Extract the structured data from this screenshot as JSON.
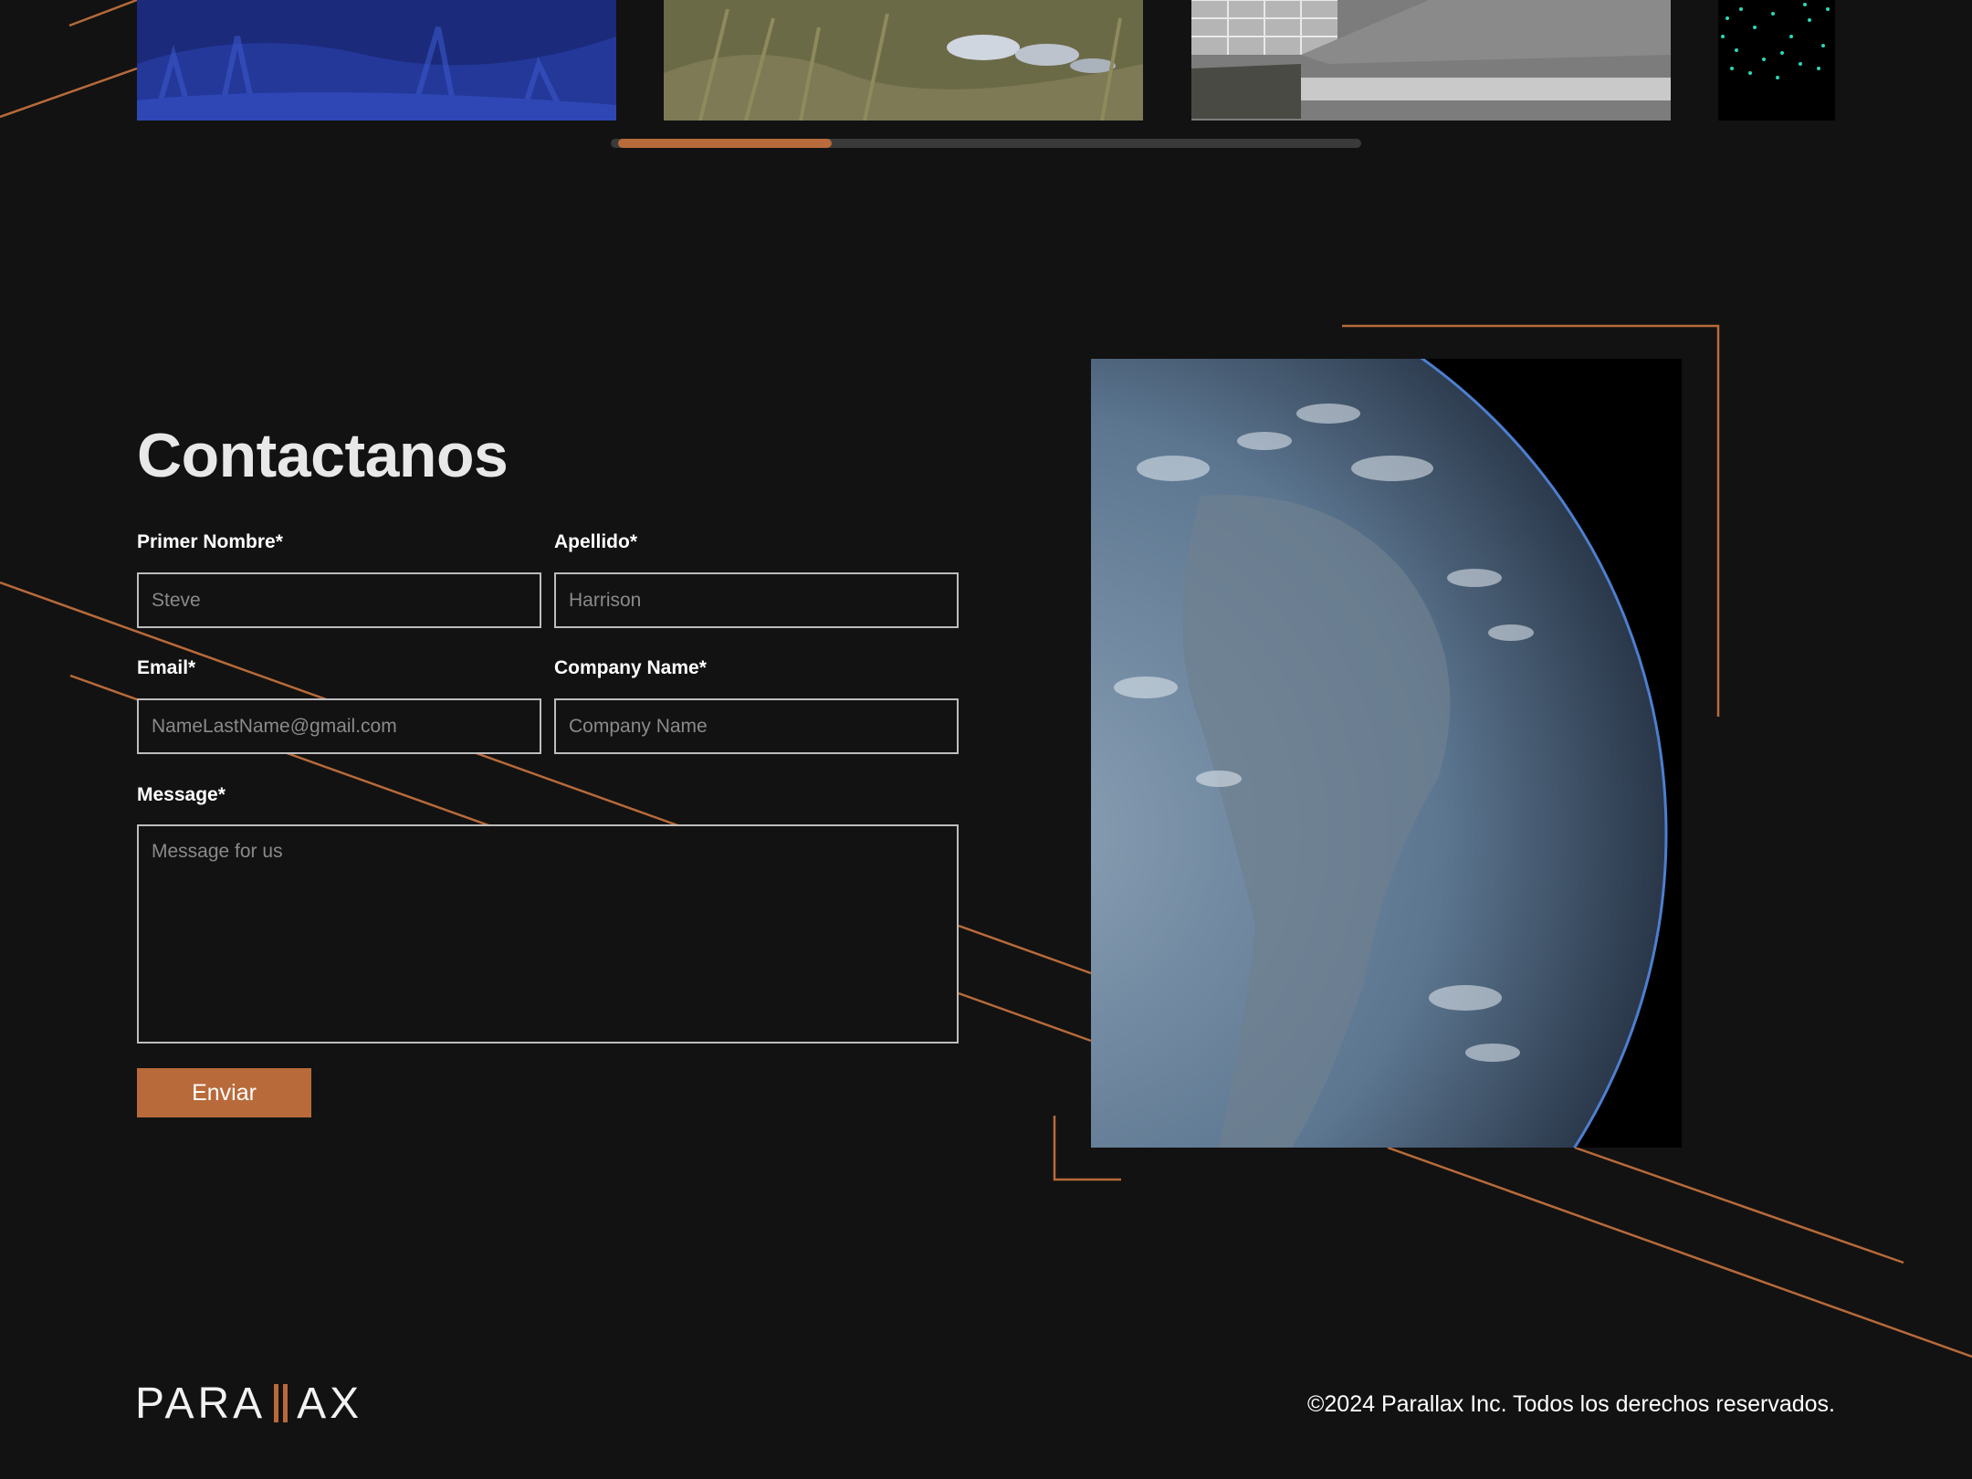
{
  "gallery": {
    "thumbnails": [
      {
        "name": "blue-landscape-thumbnail"
      },
      {
        "name": "grass-rocks-thumbnail"
      },
      {
        "name": "architecture-render-thumbnail"
      },
      {
        "name": "particles-thumbnail"
      }
    ],
    "scroll_progress": 0.29
  },
  "contact": {
    "title": "Contactanos",
    "first_name": {
      "label": "Primer Nombre*",
      "placeholder": "Steve"
    },
    "last_name": {
      "label": "Apellido*",
      "placeholder": "Harrison"
    },
    "email": {
      "label": "Email*",
      "placeholder": "NameLastName@gmail.com"
    },
    "company": {
      "label": "Company Name*",
      "placeholder": "Company Name"
    },
    "message": {
      "label": "Message*",
      "placeholder": "Message for us"
    },
    "submit_label": "Enviar"
  },
  "footer": {
    "logo_text": "PARALLAX",
    "logo_left": "PARA",
    "logo_right": "AX",
    "copyright": "©2024 Parallax Inc. Todos los derechos reservados."
  },
  "colors": {
    "background": "#121212",
    "accent": "#b86a3a",
    "text": "#ffffff",
    "field_border": "#bdbdbd"
  }
}
